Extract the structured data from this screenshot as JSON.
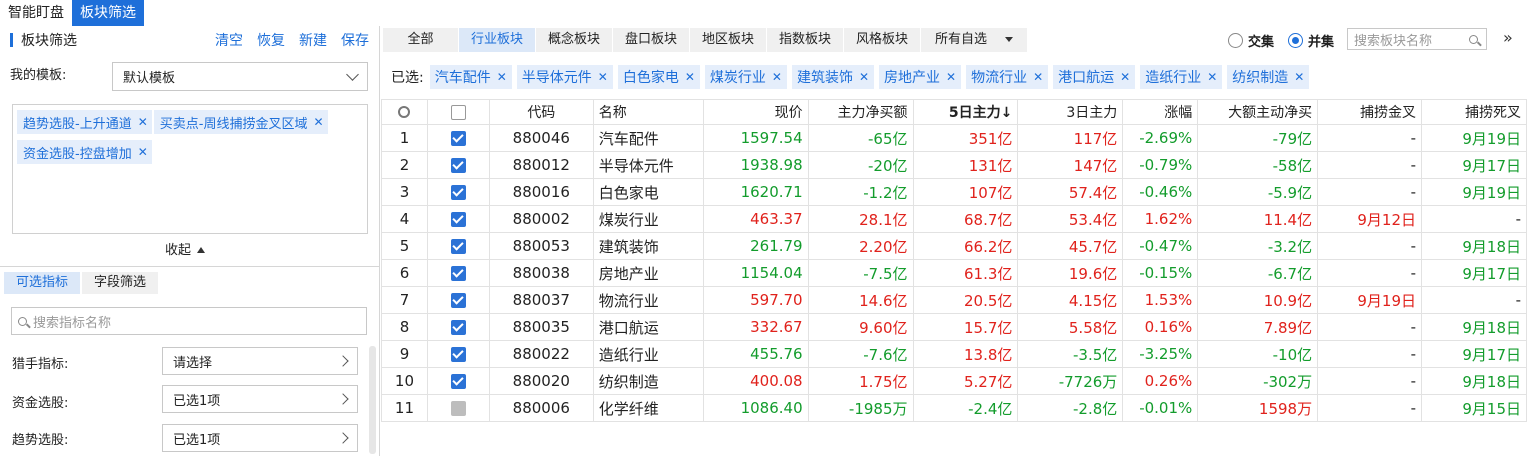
{
  "top_tabs": [
    "智能盯盘",
    "板块筛选"
  ],
  "left": {
    "title": "板块筛选",
    "actions": [
      "清空",
      "恢复",
      "新建",
      "保存"
    ],
    "template_label": "我的模板:",
    "template_value": "默认模板",
    "chips": [
      "趋势选股-上升通道",
      "买卖点-周线捕捞金叉区域",
      "资金选股-控盘增加"
    ],
    "collapse": "收起",
    "subtabs": [
      "可选指标",
      "字段筛选"
    ],
    "search_placeholder": "搜索指标名称",
    "indicators": [
      {
        "label": "猎手指标:",
        "value": "请选择"
      },
      {
        "label": "资金选股:",
        "value": "已选1项"
      },
      {
        "label": "趋势选股:",
        "value": "已选1项"
      }
    ]
  },
  "right": {
    "cat_tabs": [
      "全部",
      "行业板块",
      "概念板块",
      "盘口板块",
      "地区板块",
      "指数板块",
      "风格板块",
      "所有自选"
    ],
    "active_cat": 1,
    "mode": [
      "交集",
      "并集"
    ],
    "mode_selected": 1,
    "search_placeholder": "搜索板块名称",
    "more": "»",
    "selected_label": "已选:",
    "selected": [
      "汽车配件",
      "半导体元件",
      "白色家电",
      "煤炭行业",
      "建筑装饰",
      "房地产业",
      "物流行业",
      "港口航运",
      "造纸行业",
      "纺织制造"
    ],
    "columns": [
      "代码",
      "名称",
      "现价",
      "主力净买额",
      "5日主力↓",
      "3日主力",
      "涨幅",
      "大额主动净买",
      "捕捞金叉",
      "捕捞死叉"
    ],
    "rows": [
      {
        "n": "1",
        "check": "on",
        "code": "880046",
        "name": "汽车配件",
        "price": "1597.54",
        "net": "-65亿",
        "d5": "351亿",
        "d3": "117亿",
        "chg": "-2.69%",
        "big": "-79亿",
        "gold": "-",
        "dead": "9月19日"
      },
      {
        "n": "2",
        "check": "on",
        "code": "880012",
        "name": "半导体元件",
        "price": "1938.98",
        "net": "-20亿",
        "d5": "131亿",
        "d3": "147亿",
        "chg": "-0.79%",
        "big": "-58亿",
        "gold": "-",
        "dead": "9月17日"
      },
      {
        "n": "3",
        "check": "on",
        "code": "880016",
        "name": "白色家电",
        "price": "1620.71",
        "net": "-1.2亿",
        "d5": "107亿",
        "d3": "57.4亿",
        "chg": "-0.46%",
        "big": "-5.9亿",
        "gold": "-",
        "dead": "9月19日"
      },
      {
        "n": "4",
        "check": "on",
        "code": "880002",
        "name": "煤炭行业",
        "price": "463.37",
        "net": "28.1亿",
        "d5": "68.7亿",
        "d3": "53.4亿",
        "chg": "1.62%",
        "big": "11.4亿",
        "gold": "9月12日",
        "dead": "-"
      },
      {
        "n": "5",
        "check": "on",
        "code": "880053",
        "name": "建筑装饰",
        "price": "261.79",
        "net": "2.20亿",
        "d5": "66.2亿",
        "d3": "45.7亿",
        "chg": "-0.47%",
        "big": "-3.2亿",
        "gold": "-",
        "dead": "9月18日"
      },
      {
        "n": "6",
        "check": "on",
        "code": "880038",
        "name": "房地产业",
        "price": "1154.04",
        "net": "-7.5亿",
        "d5": "61.3亿",
        "d3": "19.6亿",
        "chg": "-0.15%",
        "big": "-6.7亿",
        "gold": "-",
        "dead": "9月17日"
      },
      {
        "n": "7",
        "check": "on",
        "code": "880037",
        "name": "物流行业",
        "price": "597.70",
        "net": "14.6亿",
        "d5": "20.5亿",
        "d3": "4.15亿",
        "chg": "1.53%",
        "big": "10.9亿",
        "gold": "9月19日",
        "dead": "-"
      },
      {
        "n": "8",
        "check": "on",
        "code": "880035",
        "name": "港口航运",
        "price": "332.67",
        "net": "9.60亿",
        "d5": "15.7亿",
        "d3": "5.58亿",
        "chg": "0.16%",
        "big": "7.89亿",
        "gold": "-",
        "dead": "9月18日"
      },
      {
        "n": "9",
        "check": "on",
        "code": "880022",
        "name": "造纸行业",
        "price": "455.76",
        "net": "-7.6亿",
        "d5": "13.8亿",
        "d3": "-3.5亿",
        "chg": "-3.25%",
        "big": "-10亿",
        "gold": "-",
        "dead": "9月17日"
      },
      {
        "n": "10",
        "check": "on",
        "code": "880020",
        "name": "纺织制造",
        "price": "400.08",
        "net": "1.75亿",
        "d5": "5.27亿",
        "d3": "-7726万",
        "chg": "0.26%",
        "big": "-302万",
        "gold": "-",
        "dead": "9月18日"
      },
      {
        "n": "11",
        "check": "part",
        "code": "880006",
        "name": "化学纤维",
        "price": "1086.40",
        "net": "-1985万",
        "d5": "-2.4亿",
        "d3": "-2.8亿",
        "chg": "-0.01%",
        "big": "1598万",
        "gold": "-",
        "dead": "9月15日"
      }
    ],
    "colors": {
      "up": "#e0221c",
      "down": "#139c2c",
      "accent": "#1e6fd9"
    }
  }
}
